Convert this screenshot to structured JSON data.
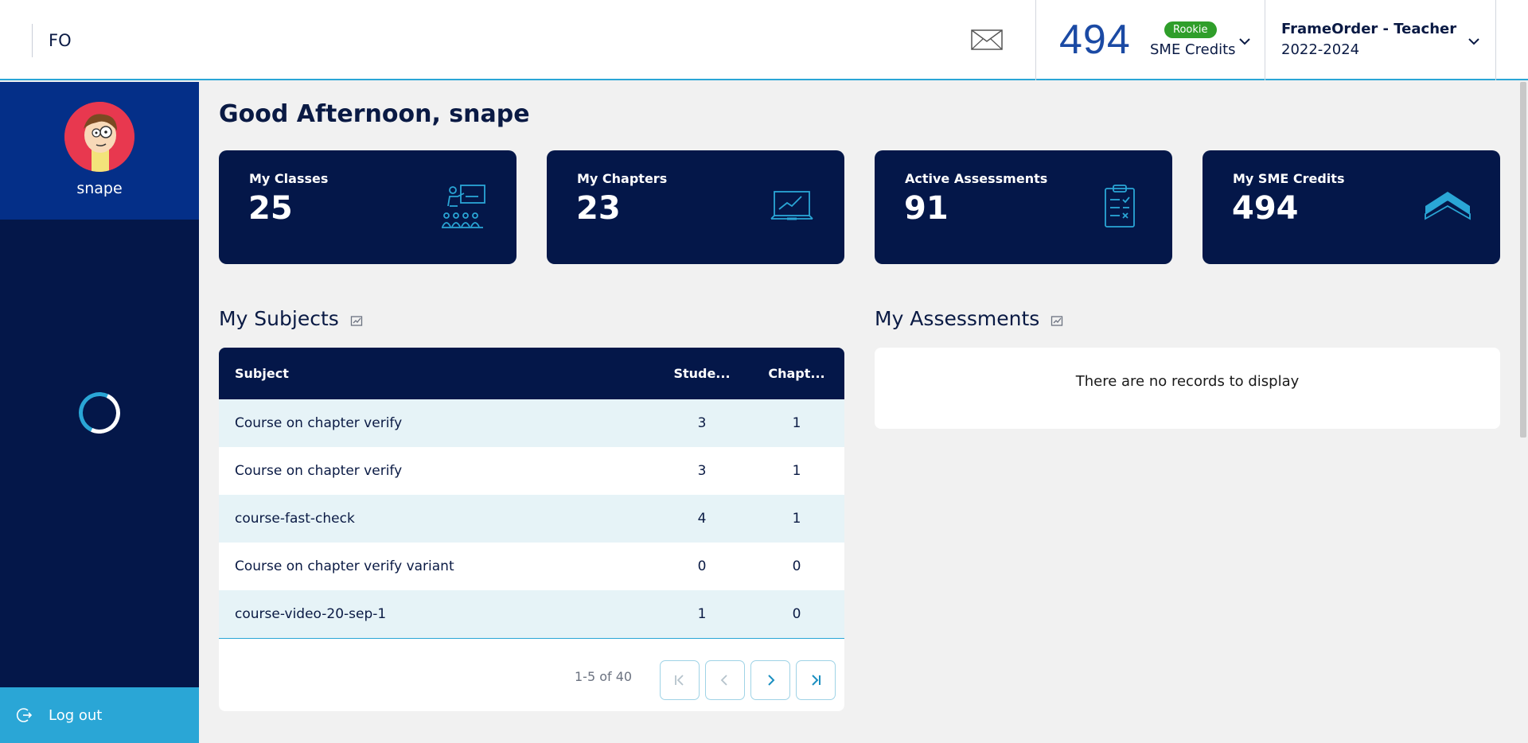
{
  "header": {
    "brand": "FO",
    "credits_value": "494",
    "credits_badge": "Rookie",
    "credits_label": "SME Credits",
    "role_title": "FrameOrder - Teacher",
    "role_year": "2022-2024"
  },
  "sidebar": {
    "username": "snape",
    "logout_label": "Log out"
  },
  "main": {
    "greeting": "Good Afternoon, snape",
    "cards": [
      {
        "label": "My Classes",
        "value": "25",
        "icon": "classroom-icon"
      },
      {
        "label": "My Chapters",
        "value": "23",
        "icon": "laptop-chart-icon"
      },
      {
        "label": "Active Assessments",
        "value": "91",
        "icon": "clipboard-icon"
      },
      {
        "label": "My SME Credits",
        "value": "494",
        "icon": "chevron-rank-icon"
      }
    ],
    "subjects": {
      "title": "My Subjects",
      "columns": [
        "Subject",
        "Stude...",
        "Chapt..."
      ],
      "rows": [
        {
          "subject": "Course on chapter verify",
          "students": "3",
          "chapters": "1"
        },
        {
          "subject": "Course on chapter verify",
          "students": "3",
          "chapters": "1"
        },
        {
          "subject": "course-fast-check",
          "students": "4",
          "chapters": "1"
        },
        {
          "subject": "Course on chapter verify variant",
          "students": "0",
          "chapters": "0"
        },
        {
          "subject": "course-video-20-sep-1",
          "students": "1",
          "chapters": "0"
        }
      ],
      "page_info": "1-5 of 40"
    },
    "assessments": {
      "title": "My Assessments",
      "empty_text": "There are no records to display"
    }
  },
  "colors": {
    "navy": "#041749",
    "accent": "#2aa6d6",
    "profile_bg": "#042f88",
    "badge_green": "#2f9e2a"
  }
}
